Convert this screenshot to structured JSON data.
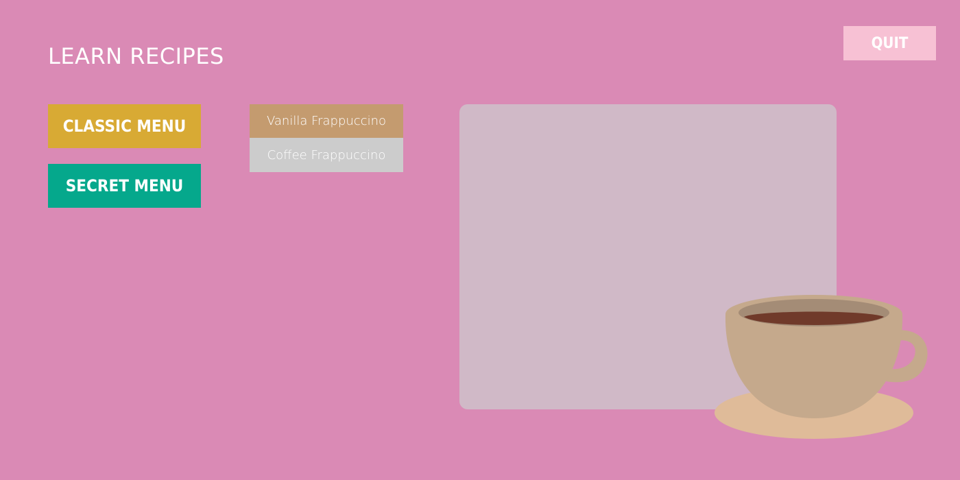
{
  "header": {
    "title": "LEARN RECIPES",
    "quit_label": "QUIT"
  },
  "menus": {
    "classic_label": "CLASSIC MENU",
    "secret_label": "SECRET MENU"
  },
  "recipes": [
    {
      "label": "Vanilla Frappuccino"
    },
    {
      "label": "Coffee Frappuccino"
    }
  ],
  "colors": {
    "background": "#DA8AB5",
    "quit_button": "#F7C1D4",
    "classic_menu": "#D8AA34",
    "secret_menu": "#05A88C",
    "recipe_selected": "#C49B6F",
    "recipe_unselected": "#CCCCCC",
    "content_panel": "#D0B9C7"
  },
  "decorations": {
    "cup_icon": "coffee-cup-icon"
  }
}
